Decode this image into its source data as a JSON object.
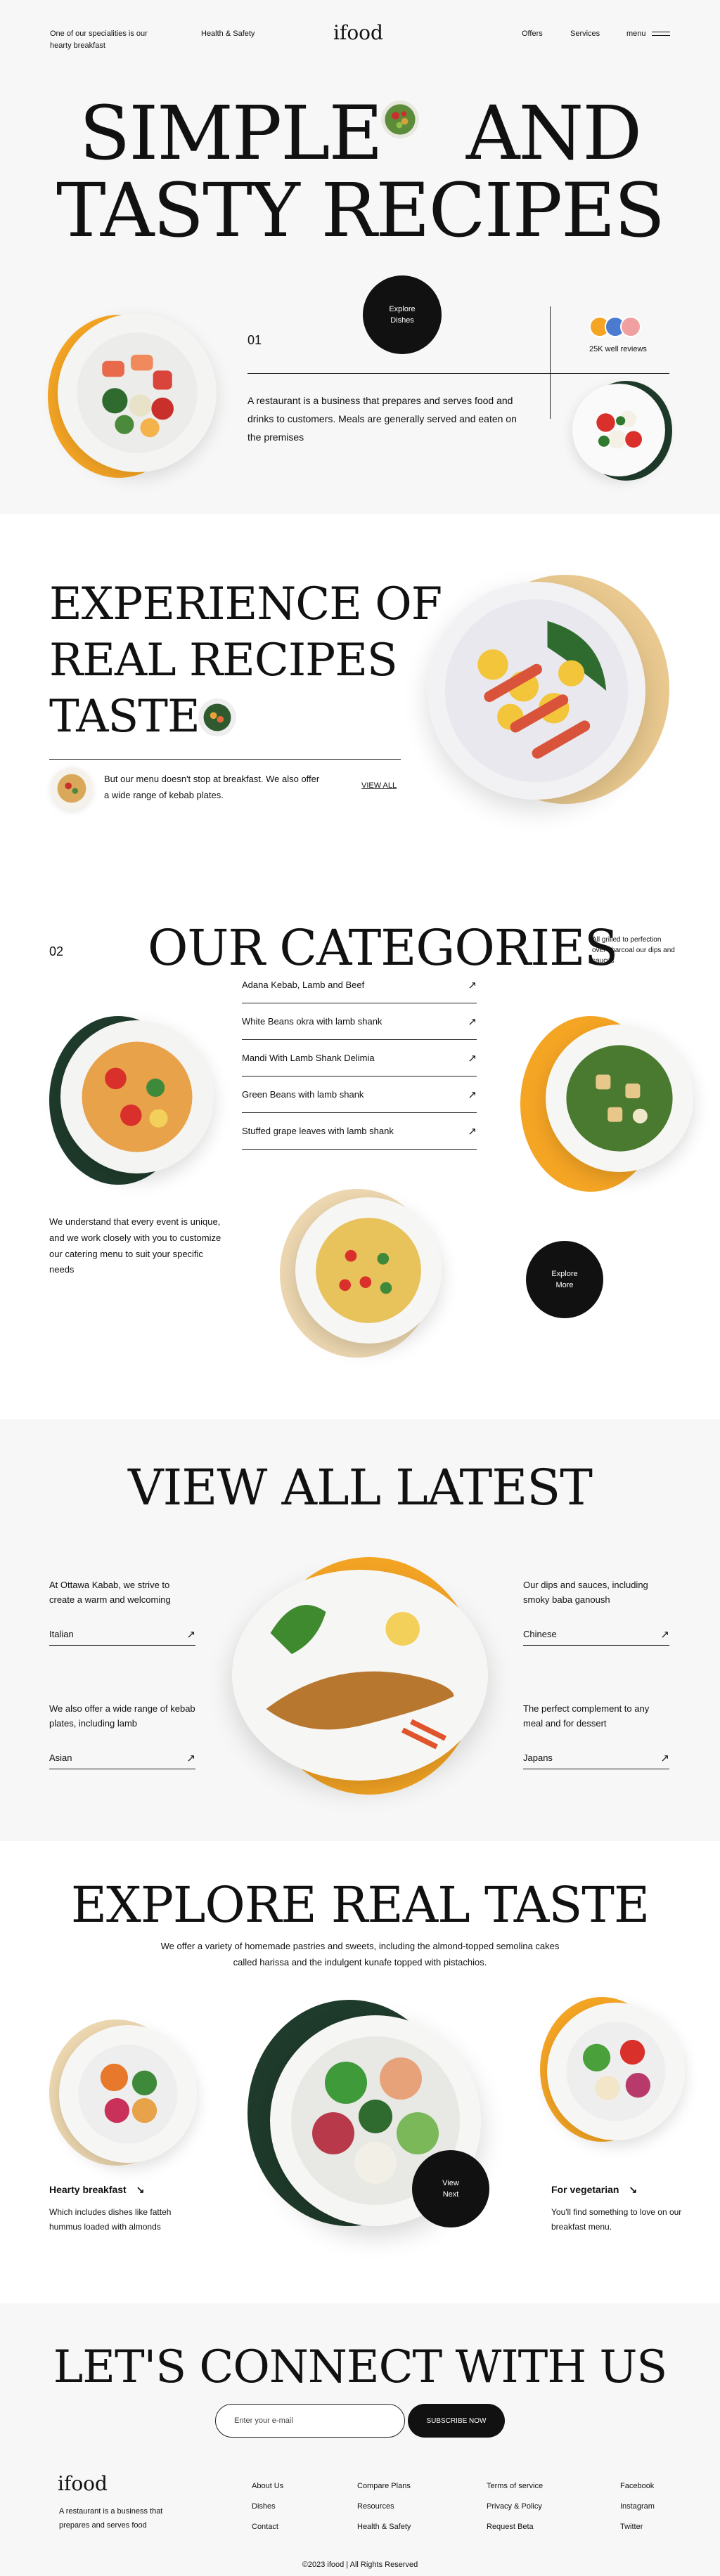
{
  "nav": {
    "tagline": "One of our specialities is our hearty breakfast",
    "health": "Health & Safety",
    "logo": "ifood",
    "offers": "Offers",
    "services": "Services",
    "menu": "menu"
  },
  "hero": {
    "line1_left": "SIMPLE",
    "line1_right": "AND",
    "line2": "TASTY RECIPES",
    "explore_button": "Explore Dishes",
    "number": "01",
    "reviews": "25K well reviews",
    "description": "A restaurant is a business that prepares and serves food and drinks to customers. Meals are generally served and eaten on the premises"
  },
  "experience": {
    "line1": "EXPERIENCE OF",
    "line2": "REAL RECIPES",
    "line3": "TASTE",
    "text": "But our menu doesn't stop at breakfast. We also offer a wide range of kebab plates.",
    "view_all": "VIEW ALL"
  },
  "categories": {
    "number": "02",
    "title": "OUR CATEGORIES",
    "side_note": "All grilled to perfection over charcoal our dips and sauces",
    "items": [
      "Adana Kebab, Lamb and Beef",
      "White Beans okra with lamb shank",
      "Mandi With Lamb Shank Delimia",
      "Green Beans with lamb shank",
      "Stuffed grape leaves with lamb shank"
    ],
    "catering_text": "We understand that every event is unique, and we work closely with you to customize our catering menu to suit your specific needs",
    "explore_button": "Explore More"
  },
  "latest": {
    "title": "VIEW ALL LATEST",
    "left_top_text": "At Ottawa Kabab, we strive to create a warm and welcoming",
    "left_top_link": "Italian",
    "left_bottom_text": "We also offer a wide range of kebab plates, including lamb",
    "left_bottom_link": "Asian",
    "right_top_text": "Our dips and sauces, including smoky baba ganoush",
    "right_top_link": "Chinese",
    "right_bottom_text": "The perfect complement to any meal and for dessert",
    "right_bottom_link": "Japans"
  },
  "explore": {
    "title": "EXPLORE REAL TASTE",
    "description": "We offer a variety of homemade pastries and sweets, including the almond-topped semolina cakes called harissa and the indulgent kunafe topped with pistachios.",
    "left_title": "Hearty breakfast",
    "left_text": "Which includes dishes like fatteh hummus loaded with almonds",
    "right_title": "For vegetarian",
    "right_text": "You'll find something to love on our breakfast menu.",
    "view_next": "View Next"
  },
  "footer": {
    "title": "LET'S CONNECT WITH US",
    "email_placeholder": "Enter your e-mail",
    "subscribe": "SUBSCRIBE NOW",
    "logo": "ifood",
    "description": "A restaurant is a business that prepares and serves food",
    "col1": [
      "About Us",
      "Dishes",
      "Contact"
    ],
    "col2": [
      "Compare Plans",
      "Resources",
      "Health & Safety"
    ],
    "col3": [
      "Terms of service",
      "Privacy & Policy",
      "Request Beta"
    ],
    "col4": [
      "Facebook",
      "Instagram",
      "Twitter"
    ],
    "copyright": "©2023 ifood | All Rights Reserved"
  },
  "colors": {
    "accent_orange": "#f5a524",
    "accent_green": "#1f3b2b",
    "accent_tan": "#e9c98f",
    "ink": "#111111",
    "light_bg": "#f6f7f6"
  },
  "icons": {
    "arrow": "north-east-arrow-icon",
    "menu": "hamburger-icon"
  }
}
